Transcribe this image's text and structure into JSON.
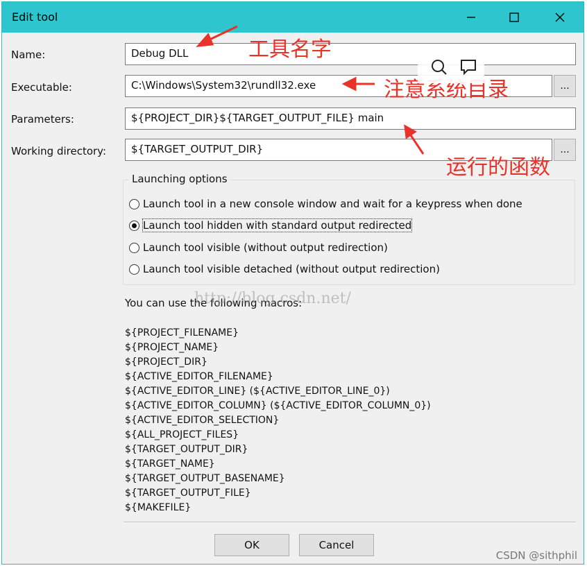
{
  "window": {
    "title": "Edit tool",
    "controls": {
      "minimize": "minimize-icon",
      "maximize": "maximize-icon",
      "close": "close-icon"
    }
  },
  "form": {
    "name_label": "Name:",
    "name_value": "Debug DLL",
    "executable_label": "Executable:",
    "executable_value": "C:\\Windows\\System32\\rundll32.exe",
    "parameters_label": "Parameters:",
    "parameters_value": "${PROJECT_DIR}${TARGET_OUTPUT_FILE} main",
    "working_dir_label": "Working directory:",
    "working_dir_value": "${TARGET_OUTPUT_DIR}",
    "browse_label": "..."
  },
  "launching": {
    "legend": "Launching options",
    "options": [
      {
        "label": "Launch tool in a new console window and wait for a keypress when done",
        "selected": false
      },
      {
        "label": "Launch tool hidden with standard output redirected",
        "selected": true
      },
      {
        "label": "Launch tool visible (without output redirection)",
        "selected": false
      },
      {
        "label": "Launch tool visible detached (without output redirection)",
        "selected": false
      }
    ]
  },
  "macros": {
    "intro": "You can use the following macros:",
    "items": [
      "${PROJECT_FILENAME}",
      "${PROJECT_NAME}",
      "${PROJECT_DIR}",
      "${ACTIVE_EDITOR_FILENAME}",
      "${ACTIVE_EDITOR_LINE} (${ACTIVE_EDITOR_LINE_0})",
      "${ACTIVE_EDITOR_COLUMN} (${ACTIVE_EDITOR_COLUMN_0})",
      "${ACTIVE_EDITOR_SELECTION}",
      "${ALL_PROJECT_FILES}",
      "${TARGET_OUTPUT_DIR}",
      "${TARGET_NAME}",
      "${TARGET_OUTPUT_BASENAME}",
      "${TARGET_OUTPUT_FILE}",
      "${MAKEFILE}"
    ]
  },
  "buttons": {
    "ok": "OK",
    "cancel": "Cancel"
  },
  "annotations": {
    "tool_name": "工具名字",
    "system_dir": "注意系统目录",
    "function": "运行的函数",
    "color": "#e8322a"
  },
  "watermark": "http://blog.csdn.net/",
  "credit": "CSDN @sithphil",
  "colors": {
    "titlebar": "#2ec5cf",
    "dialog": "#f0f0f0"
  }
}
